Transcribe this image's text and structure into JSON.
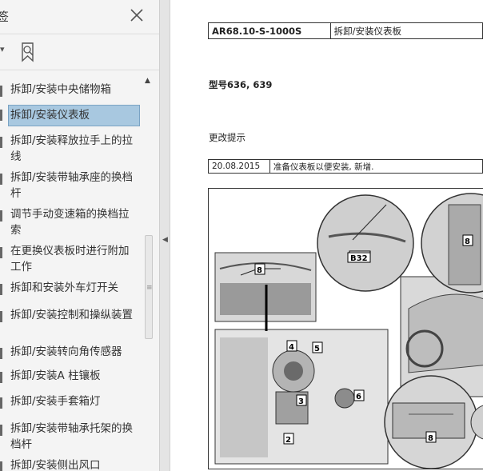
{
  "sidebar": {
    "title_fragment": "签",
    "items": [
      {
        "label": "拆卸/安装中央储物箱"
      },
      {
        "label": "拆卸/安装仪表板",
        "selected": true
      },
      {
        "label": "拆卸/安装释放拉手上的拉线"
      },
      {
        "label": "拆卸/安装带轴承座的换档杆"
      },
      {
        "label": "调节手动变速箱的换档拉索"
      },
      {
        "label": "在更换仪表板时进行附加工作"
      },
      {
        "label": "拆卸和安装外车灯开关"
      },
      {
        "label": "拆卸/安装控制和操纵装置"
      },
      {
        "label": "拆卸/安装转向角传感器"
      },
      {
        "label": "拆卸/安装A 柱镶板"
      },
      {
        "label": "拆卸/安装手套箱灯"
      },
      {
        "label": "拆卸/安装带轴承托架的换档杆"
      },
      {
        "label": "拆卸/安装侧出风口"
      }
    ]
  },
  "document": {
    "code": "AR68.10-S-1000S",
    "title": "拆卸/安装仪表板",
    "model": "型号636, 639",
    "changes_heading": "更改提示",
    "change_date": "20.08.2015",
    "change_note": "准备仪表板以便安装, 新增.",
    "figure_callouts": [
      "8",
      "B32",
      "8",
      "4",
      "5",
      "3",
      "6",
      "2",
      "8"
    ]
  },
  "colors": {
    "selection": "#a8c8e0",
    "sidebar_bg": "#f4f4f4"
  }
}
